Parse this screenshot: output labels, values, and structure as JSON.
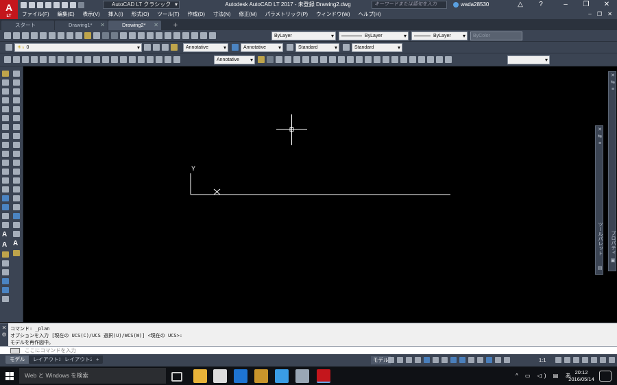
{
  "app": {
    "logo": "A",
    "logo_sub": "LT",
    "title": "Autodesk AutoCAD LT 2017 - 未登録   Drawing2.dwg",
    "workspace": "AutoCAD LT クラシック",
    "search_placeholder": "キーワードまたは語句を入力",
    "user": "wada28530"
  },
  "menu": [
    "ファイル(F)",
    "編集(E)",
    "表示(V)",
    "挿入(I)",
    "形式(O)",
    "ツール(T)",
    "作成(D)",
    "寸法(N)",
    "修正(M)",
    "パラメトリック(P)",
    "ウィンドウ(W)",
    "ヘルプ(H)"
  ],
  "tabs": [
    {
      "label": "スタート",
      "active": false
    },
    {
      "label": "Drawing1*",
      "active": false
    },
    {
      "label": "Drawing2*",
      "active": true
    }
  ],
  "properties": {
    "color": "ByLayer",
    "linetype": "ByLayer",
    "lineweight": "ByLayer",
    "plotstyle": "ByColor"
  },
  "layer": {
    "current": "0"
  },
  "styles": {
    "text_scale": "Annotative",
    "dim_style": "Annotative",
    "table_style": "Standard",
    "mleader_style": "Standard",
    "annotative2": "Annotative"
  },
  "canvas": {
    "ucs_label": "Y",
    "cursor_color": "#ffffff"
  },
  "palettes": {
    "properties": "プロパティ",
    "tool_palette": "ツールパレット"
  },
  "command": {
    "history": [
      "コマンド: _plan",
      "オプションを入力 [現在の UCS(C)/UCS 選択(U)/WCS(W)] <現在の UCS>:",
      "モデルを再作図中。"
    ],
    "placeholder": "ここにコマンドを入力"
  },
  "layouts": [
    {
      "label": "モデル",
      "active": true
    },
    {
      "label": "レイアウト1",
      "active": false
    },
    {
      "label": "レイアウト2",
      "active": false
    }
  ],
  "status": {
    "model": "モデル",
    "scale": "1:1"
  },
  "taskbar": {
    "search": "Web と Windows を検索",
    "time": "20:12",
    "date": "2016/05/14",
    "ime": "あ"
  }
}
